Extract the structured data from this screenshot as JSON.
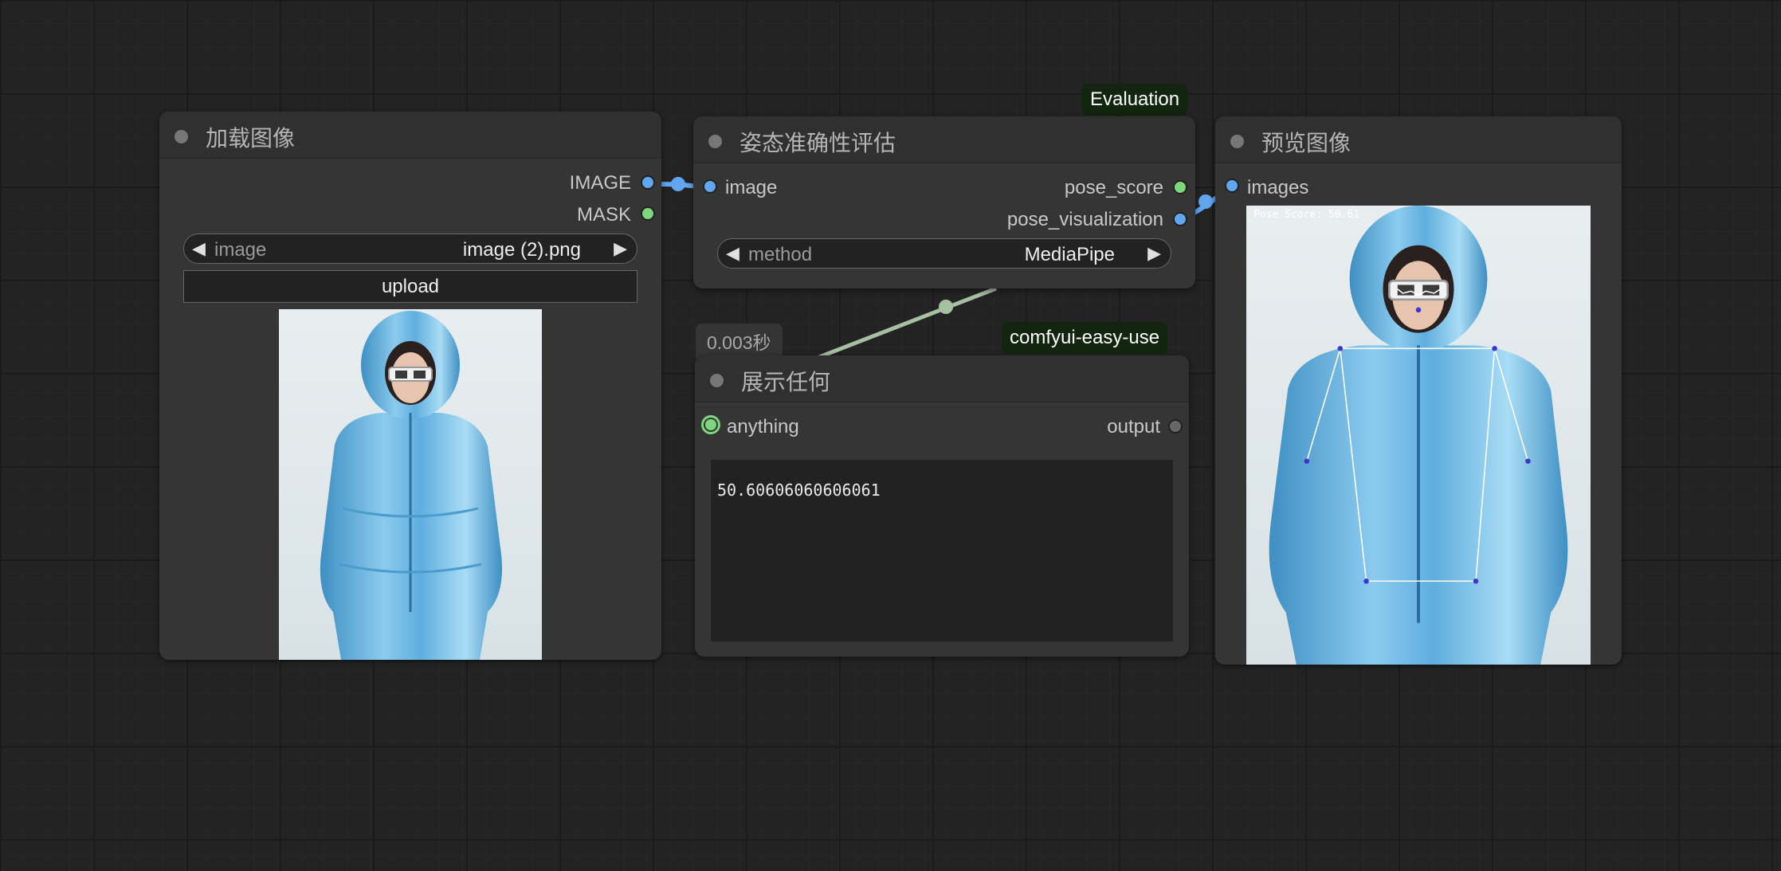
{
  "colors": {
    "canvas_bg": "#232323",
    "node_bg": "#353535",
    "image_link": "#61a6ef",
    "number_link": "#a7bfa3",
    "badge_bg": "#12250f"
  },
  "nodes": {
    "load_image": {
      "title": "加载图像",
      "outputs": [
        "IMAGE",
        "MASK"
      ],
      "image_widget": {
        "name": "image",
        "value": "image (2).png"
      },
      "upload_label": "upload"
    },
    "pose_eval": {
      "title": "姿态准确性评估",
      "badge": "Evaluation",
      "input": "image",
      "outputs": [
        "pose_score",
        "pose_visualization"
      ],
      "method_widget": {
        "name": "method",
        "value": "MediaPipe"
      }
    },
    "show_any": {
      "title": "展示任何",
      "badge": "comfyui-easy-use",
      "exec_time": "0.003秒",
      "input": "anything",
      "output": "output",
      "text_value": "50.60606060606061"
    },
    "preview": {
      "title": "预览图像",
      "input": "images",
      "overlay_text": "Pose Score: 50.61"
    }
  }
}
